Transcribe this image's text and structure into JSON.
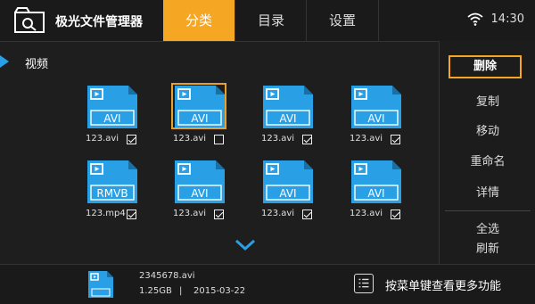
{
  "app": {
    "title": "极光文件管理器"
  },
  "tabs": [
    {
      "label": "分类",
      "active": true
    },
    {
      "label": "目录",
      "active": false
    },
    {
      "label": "设置",
      "active": false
    }
  ],
  "status": {
    "time": "14:30",
    "wifi": "wifi-icon"
  },
  "section": {
    "title": "视频"
  },
  "files": [
    {
      "type": "AVI",
      "name": "123.avi",
      "checked": true,
      "selected": false
    },
    {
      "type": "AVI",
      "name": "123.avi",
      "checked": false,
      "selected": true
    },
    {
      "type": "AVI",
      "name": "123.avi",
      "checked": true,
      "selected": false
    },
    {
      "type": "AVI",
      "name": "123.avi",
      "checked": true,
      "selected": false
    },
    {
      "type": "RMVB",
      "name": "123.mp4",
      "checked": true,
      "selected": false
    },
    {
      "type": "AVI",
      "name": "123.avi",
      "checked": true,
      "selected": false
    },
    {
      "type": "AVI",
      "name": "123.avi",
      "checked": true,
      "selected": false
    },
    {
      "type": "AVI",
      "name": "123.avi",
      "checked": true,
      "selected": false
    }
  ],
  "side_menu": {
    "delete": "删除",
    "copy": "复制",
    "move": "移动",
    "rename": "重命名",
    "details": "详情",
    "select_all": "全选",
    "refresh": "刷新"
  },
  "bottom": {
    "file_name": "2345678.avi",
    "file_size": "1.25GB",
    "separator": "|",
    "date": "2015-03-22",
    "hint": "按菜单键查看更多功能"
  },
  "colors": {
    "accent": "#f5a623",
    "file_blue": "#29a0e6",
    "section_marker": "#29a0e6"
  }
}
